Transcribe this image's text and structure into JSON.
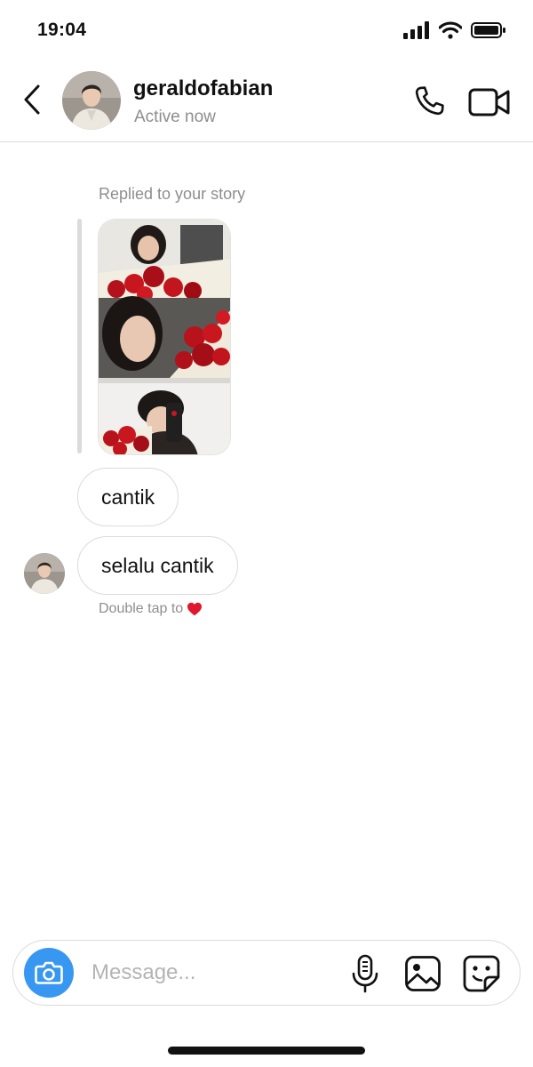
{
  "status_bar": {
    "time": "19:04"
  },
  "header": {
    "username": "geraldofabian",
    "presence": "Active now",
    "back_icon": "chevron-left-icon",
    "call_icon": "phone-icon",
    "video_icon": "video-camera-icon"
  },
  "conversation": {
    "reply_context": "Replied to your story",
    "messages": [
      {
        "text": "cantik"
      },
      {
        "text": "selalu cantik"
      }
    ],
    "hint": {
      "text": "Double tap to",
      "emoji": "❤️"
    }
  },
  "composer": {
    "placeholder": "Message...",
    "camera_icon": "camera-icon",
    "mic_icon": "microphone-icon",
    "gallery_icon": "image-icon",
    "sticker_icon": "sticker-icon"
  },
  "colors": {
    "accent": "#3897f0",
    "border": "#dbdbdb",
    "muted_text": "#8e8e8e",
    "heart": "#e0182d"
  }
}
